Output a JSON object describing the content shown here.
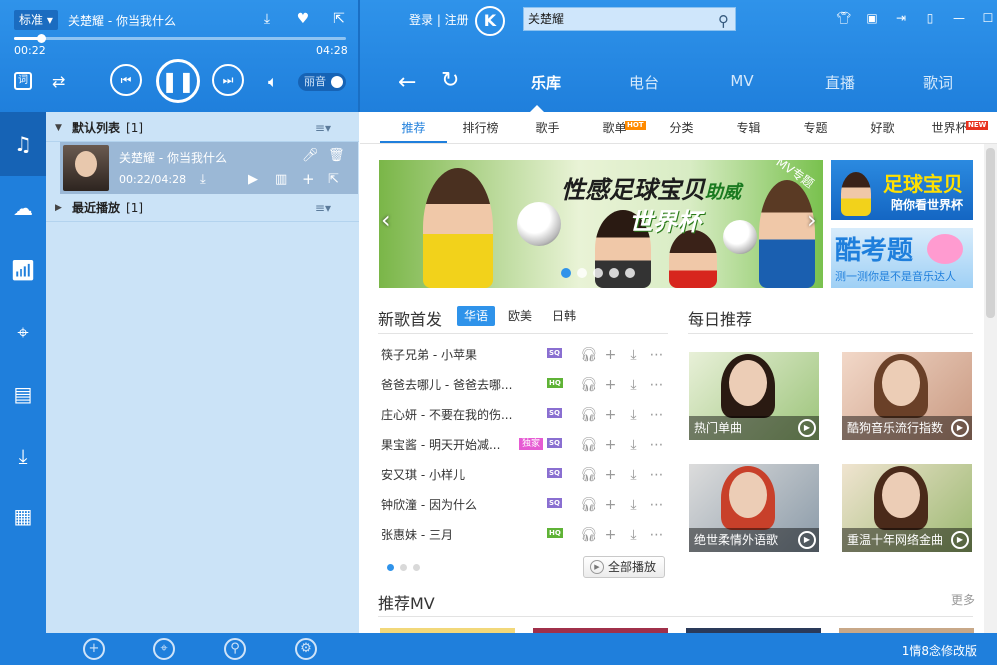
{
  "player": {
    "mode": "标准",
    "now_playing": "关楚耀 - 你当我什么",
    "elapsed": "00:22",
    "duration": "04:28",
    "progress_fraction": 0.082,
    "sound_effect": "丽音"
  },
  "header": {
    "login": "登录 | 注册",
    "logo": "K",
    "search_value": "关楚耀"
  },
  "nav": {
    "tabs": [
      "乐库",
      "电台",
      "MV",
      "直播",
      "歌词"
    ],
    "active": "乐库"
  },
  "subtabs": {
    "items": [
      "推荐",
      "排行榜",
      "歌手",
      "歌单",
      "分类",
      "专辑",
      "专题",
      "好歌",
      "世界杯"
    ],
    "hot_badge": "HOT",
    "new_badge": "NEW"
  },
  "playlist": {
    "default_group": "默认列表",
    "default_count": "[1]",
    "current_song": "关楚耀 - 你当我什么",
    "current_time": "00:22/04:28",
    "recent_group": "最近播放",
    "recent_count": "[1]"
  },
  "banner": {
    "line1": "性感足球宝贝",
    "line1_suffix": "助威",
    "line2": "世界杯",
    "tag": "MV专题"
  },
  "ads": {
    "ad1_title": "足球宝贝",
    "ad1_sub": "陪你看世界杯",
    "ad2_title": "酷考题",
    "ad2_sub": "测一测你是不是音乐达人"
  },
  "new_songs": {
    "title": "新歌首发",
    "tabs": [
      "华语",
      "欧美",
      "日韩"
    ],
    "items": [
      {
        "text": "筷子兄弟 - 小苹果",
        "quality": "SQ",
        "tag": ""
      },
      {
        "text": "爸爸去哪儿 - 爸爸去哪...",
        "quality": "HQ",
        "tag": ""
      },
      {
        "text": "庄心妍 - 不要在我的伤...",
        "quality": "SQ",
        "tag": ""
      },
      {
        "text": "果宝酱 - 明天开始减...",
        "quality": "SQ",
        "tag": "独家"
      },
      {
        "text": "安又琪 - 小样儿",
        "quality": "SQ",
        "tag": ""
      },
      {
        "text": "钟欣潼 - 因为什么",
        "quality": "SQ",
        "tag": ""
      },
      {
        "text": "张惠妹 - 三月",
        "quality": "HQ",
        "tag": ""
      }
    ],
    "play_all": "全部播放"
  },
  "daily": {
    "title": "每日推荐",
    "cards": [
      "热门单曲",
      "酷狗音乐流行指数",
      "绝世柔情外语歌",
      "重温十年网络金曲"
    ]
  },
  "mv": {
    "title": "推荐MV",
    "more": "更多"
  },
  "status": "1情8念修改版",
  "colors": {
    "accent": "#1f7fdc",
    "sq": "#8a6fd1",
    "hq": "#5fb336",
    "hot": "#ff8a00",
    "new": "#e8321e"
  }
}
